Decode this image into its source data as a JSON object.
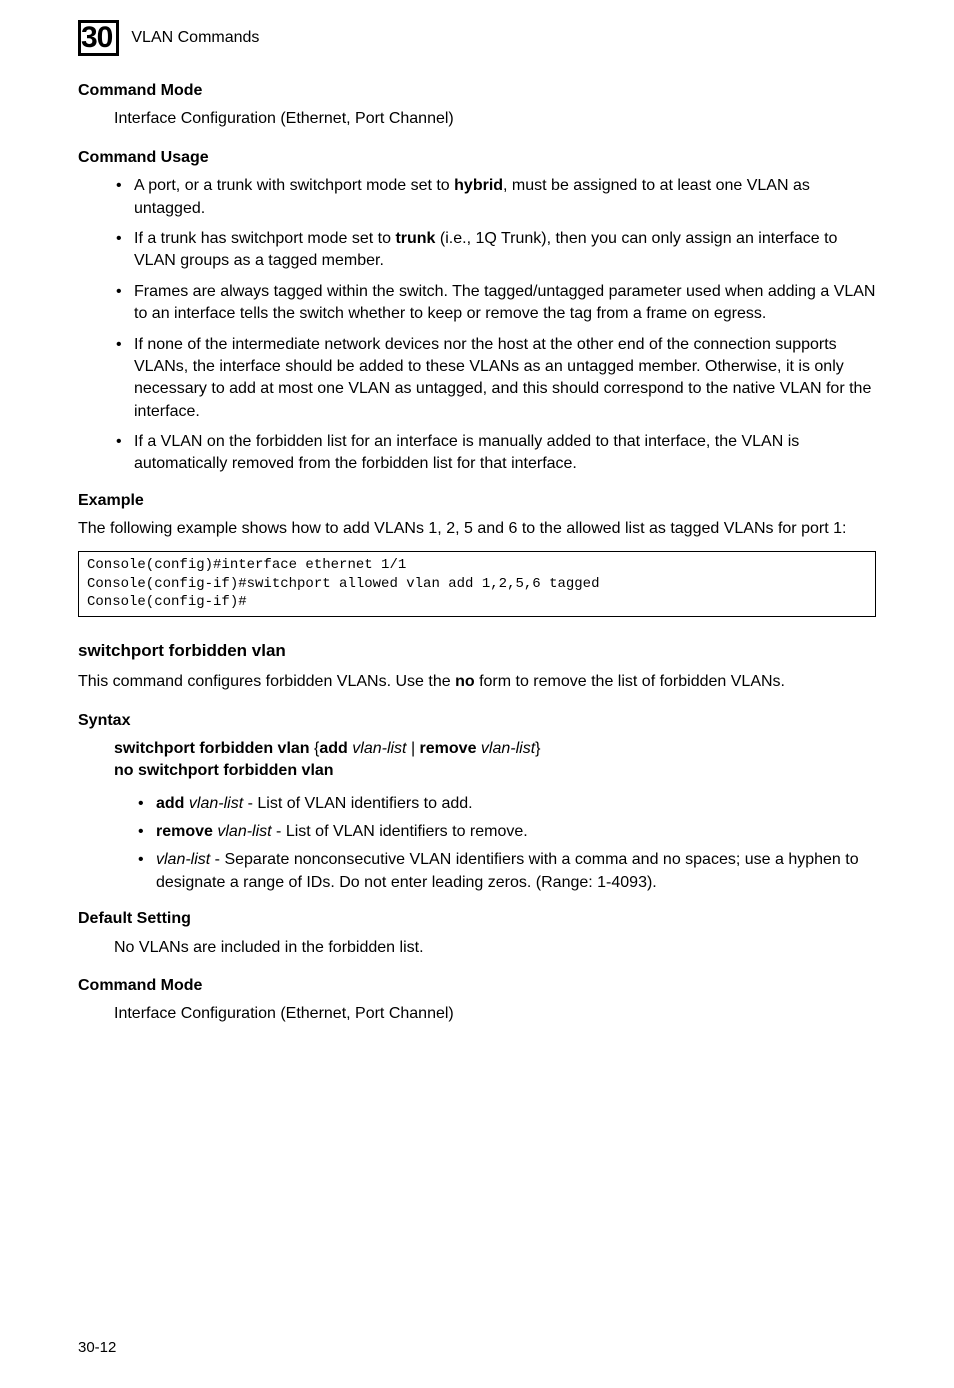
{
  "chapter": {
    "number": "30",
    "title": "VLAN Commands"
  },
  "commandMode1": {
    "head": "Command Mode",
    "text": "Interface Configuration (Ethernet, Port Channel)"
  },
  "commandUsage": {
    "head": "Command Usage",
    "b1a": "A port, or a trunk with switchport mode set to ",
    "b1b": "hybrid",
    "b1c": ", must be assigned to at least one VLAN as untagged.",
    "b2a": "If a trunk has switchport mode set to ",
    "b2b": "trunk",
    "b2c": " (i.e., 1Q Trunk), then you can only assign an interface to VLAN groups as a tagged member.",
    "b3": "Frames are always tagged within the switch. The tagged/untagged parameter used when adding a VLAN to an interface tells the switch whether to keep or remove the tag from a frame on egress.",
    "b4": "If none of the intermediate network devices nor the host at the other end of the connection supports VLANs, the interface should be added to these VLANs as an untagged member. Otherwise, it is only necessary to add at most one VLAN as untagged, and this should correspond to the native VLAN for the interface.",
    "b5": "If a VLAN on the forbidden list for an interface is manually added to that interface, the VLAN is automatically removed from the forbidden list for that interface."
  },
  "example": {
    "head": "Example",
    "intro": "The following example shows how to add VLANs 1, 2, 5 and 6 to the allowed list as tagged VLANs for port 1:",
    "code": "Console(config)#interface ethernet 1/1\nConsole(config-if)#switchport allowed vlan add 1,2,5,6 tagged\nConsole(config-if)#"
  },
  "forbidden": {
    "title": "switchport forbidden vlan",
    "descA": "This command configures forbidden VLANs. Use the ",
    "descB": "no",
    "descC": " form to remove the list of forbidden VLANs."
  },
  "syntax": {
    "head": "Syntax",
    "l1a": "switchport forbidden vlan",
    "l1b": " {",
    "l1c": "add",
    "l1d": " ",
    "l1e": "vlan-list",
    "l1f": " | ",
    "l1g": "remove",
    "l1h": " ",
    "l1i": "vlan-list",
    "l1j": "}",
    "l2": "no switchport forbidden vlan",
    "s1a": "add",
    "s1b": " ",
    "s1c": "vlan-list",
    "s1d": " - List of VLAN identifiers to add.",
    "s2a": "remove",
    "s2b": " ",
    "s2c": "vlan-list",
    "s2d": " - List of VLAN identifiers to remove.",
    "s3a": "vlan-list",
    "s3b": " - Separate nonconsecutive VLAN identifiers with a comma and no spaces; use a hyphen to designate a range of IDs. Do not enter leading zeros. (Range: 1-4093)."
  },
  "defaultSetting": {
    "head": "Default Setting",
    "text": "No VLANs are included in the forbidden list."
  },
  "commandMode2": {
    "head": "Command Mode",
    "text": "Interface Configuration (Ethernet, Port Channel)"
  },
  "footer": "30-12"
}
